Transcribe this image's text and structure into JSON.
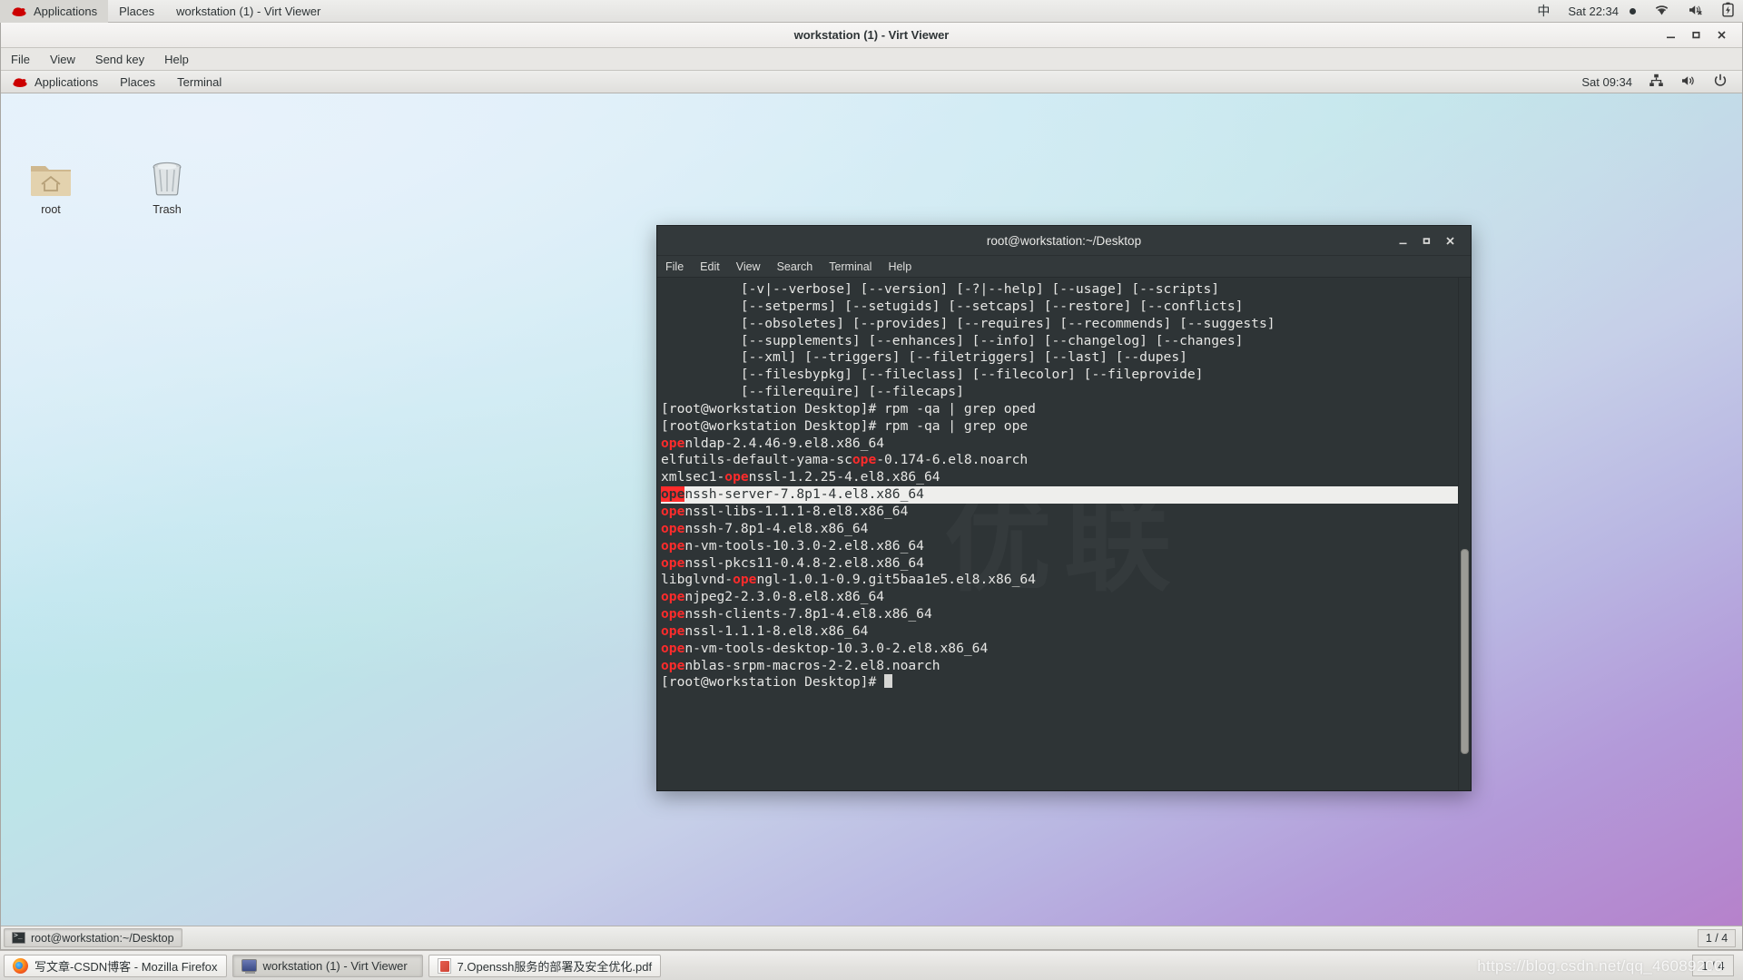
{
  "host_topbar": {
    "logo_icon": "redhat-logo-icon",
    "items": [
      {
        "label": "Applications"
      },
      {
        "label": "Places"
      },
      {
        "label": "workstation (1) - Virt Viewer"
      }
    ],
    "ime_label": "中",
    "clock": "Sat 22:34",
    "tray": [
      {
        "icon": "wifi-icon"
      },
      {
        "icon": "speaker-muted-icon"
      },
      {
        "icon": "battery-charging-icon"
      }
    ]
  },
  "virt_viewer": {
    "title": "workstation (1) - Virt Viewer",
    "menu": [
      {
        "label": "File"
      },
      {
        "label": "View"
      },
      {
        "label": "Send key"
      },
      {
        "label": "Help"
      }
    ],
    "controls": {
      "minimize": "–",
      "maximize": "❐",
      "close": "✕"
    }
  },
  "guest_panel": {
    "logo_icon": "redhat-logo-icon",
    "items": [
      {
        "label": "Applications"
      },
      {
        "label": "Places"
      },
      {
        "label": "Terminal"
      }
    ],
    "clock": "Sat 09:34",
    "tray": [
      {
        "icon": "network-icon"
      },
      {
        "icon": "speaker-icon"
      },
      {
        "icon": "power-icon"
      }
    ]
  },
  "desktop_icons": [
    {
      "label": "root",
      "icon": "home-folder-icon"
    },
    {
      "label": "Trash",
      "icon": "trash-icon"
    }
  ],
  "terminal": {
    "title": "root@workstation:~/Desktop",
    "menu": [
      {
        "label": "File"
      },
      {
        "label": "Edit"
      },
      {
        "label": "View"
      },
      {
        "label": "Search"
      },
      {
        "label": "Terminal"
      },
      {
        "label": "Help"
      }
    ],
    "controls": {
      "minimize": "_",
      "maximize": "❐",
      "close": "✕"
    },
    "watermark": "优联",
    "highlight_term": "ope",
    "highlight_color": "#ff2b2b",
    "background_color": "#2e3436",
    "lines": [
      {
        "text": "          [-v|--verbose] [--version] [-?|--help] [--usage] [--scripts]"
      },
      {
        "text": "          [--setperms] [--setugids] [--setcaps] [--restore] [--conflicts]"
      },
      {
        "text": "          [--obsoletes] [--provides] [--requires] [--recommends] [--suggests]"
      },
      {
        "text": "          [--supplements] [--enhances] [--info] [--changelog] [--changes]"
      },
      {
        "text": "          [--xml] [--triggers] [--filetriggers] [--last] [--dupes]"
      },
      {
        "text": "          [--filesbypkg] [--fileclass] [--filecolor] [--fileprovide]"
      },
      {
        "text": "          [--filerequire] [--filecaps]"
      },
      {
        "text": "[root@workstation Desktop]# rpm -qa | grep oped"
      },
      {
        "text": "[root@workstation Desktop]# rpm -qa | grep ope"
      },
      {
        "text": "openldap-2.4.46-9.el8.x86_64"
      },
      {
        "text": "elfutils-default-yama-scope-0.174-6.el8.noarch"
      },
      {
        "text": "xmlsec1-openssl-1.2.25-4.el8.x86_64"
      },
      {
        "text": "openssh-server-7.8p1-4.el8.x86_64",
        "selected": true
      },
      {
        "text": "openssl-libs-1.1.1-8.el8.x86_64"
      },
      {
        "text": "openssh-7.8p1-4.el8.x86_64"
      },
      {
        "text": "open-vm-tools-10.3.0-2.el8.x86_64"
      },
      {
        "text": "openssl-pkcs11-0.4.8-2.el8.x86_64"
      },
      {
        "text": "libglvnd-opengl-1.0.1-0.9.git5baa1e5.el8.x86_64"
      },
      {
        "text": "openjpeg2-2.3.0-8.el8.x86_64"
      },
      {
        "text": "openssh-clients-7.8p1-4.el8.x86_64"
      },
      {
        "text": "openssl-1.1.1-8.el8.x86_64"
      },
      {
        "text": "open-vm-tools-desktop-10.3.0-2.el8.x86_64"
      },
      {
        "text": "openblas-srpm-macros-2-2.el8.noarch"
      },
      {
        "text": "[root@workstation Desktop]# ",
        "cursor": true
      }
    ]
  },
  "guest_taskbar": {
    "buttons": [
      {
        "label": "root@workstation:~/Desktop",
        "icon": "terminal-icon",
        "active": true
      }
    ],
    "workspace": "1 / 4"
  },
  "host_taskbar": {
    "buttons": [
      {
        "label": "写文章-CSDN博客 - Mozilla Firefox",
        "icon": "firefox-icon",
        "active": false
      },
      {
        "label": "workstation (1) - Virt Viewer",
        "icon": "virt-viewer-icon",
        "active": true
      },
      {
        "label": "7.Openssh服务的部署及安全优化.pdf",
        "icon": "pdf-icon",
        "active": false
      }
    ],
    "workspace": "1 / 4",
    "watermark": "https://blog.csdn.net/qq_46089200"
  }
}
